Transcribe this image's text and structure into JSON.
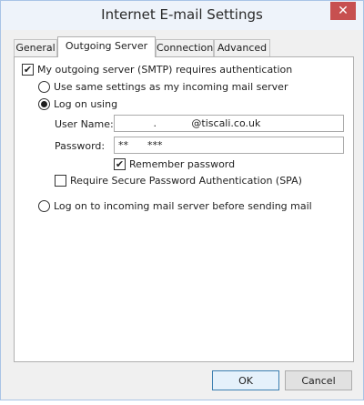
{
  "window": {
    "title": "Internet E-mail Settings"
  },
  "tabs": [
    {
      "label": "General"
    },
    {
      "label": "Outgoing Server"
    },
    {
      "label": "Connection"
    },
    {
      "label": "Advanced"
    }
  ],
  "outgoing": {
    "smtp_auth_label": "My outgoing server (SMTP) requires authentication",
    "same_settings_label": "Use same settings as my incoming mail server",
    "log_on_using_label": "Log on using",
    "username_label": "User Name:",
    "username_value": "           .           @tiscali.co.uk",
    "password_label": "Password:",
    "password_value": "**      ***",
    "remember_label": "Remember password",
    "spa_label": "Require Secure Password Authentication (SPA)",
    "logon_incoming_label": "Log on to incoming mail server before sending mail"
  },
  "buttons": {
    "ok": "OK",
    "cancel": "Cancel"
  }
}
